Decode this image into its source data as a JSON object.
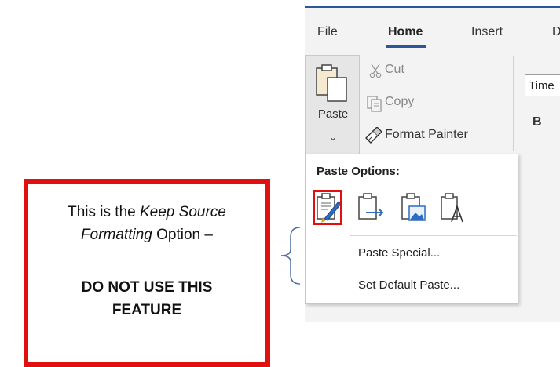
{
  "ribbon": {
    "tabs": [
      "File",
      "Home",
      "Insert",
      "D"
    ],
    "active_tab": "Home",
    "paste_label": "Paste",
    "paste_chevron": "⌄",
    "cut_label": "Cut",
    "copy_label": "Copy",
    "format_painter_label": "Format Painter",
    "font_name": "Time",
    "bold_label": "B"
  },
  "dropdown": {
    "header": "Paste Options:",
    "options": [
      {
        "icon": "keep-source-formatting-icon"
      },
      {
        "icon": "merge-formatting-icon"
      },
      {
        "icon": "picture-icon"
      },
      {
        "icon": "keep-text-only-icon"
      }
    ],
    "paste_special": "Paste Special...",
    "set_default_paste": "Set Default Paste..."
  },
  "annotation": {
    "line1_plain": "This is the ",
    "line1_italic": "Keep Source",
    "line2_italic": "Formatting",
    "line2_plain": " Option –",
    "warning_line1": "DO NOT USE THIS",
    "warning_line2": "FEATURE"
  },
  "colors": {
    "highlight": "#e01010",
    "accent": "#2b579a"
  }
}
